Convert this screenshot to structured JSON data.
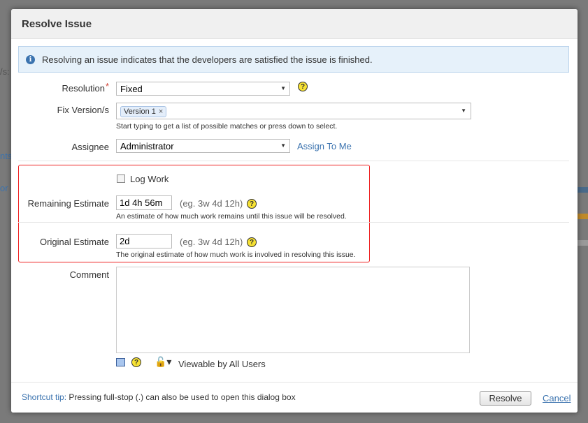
{
  "background": {
    "fragments": [
      "/s:",
      "nts",
      "or"
    ]
  },
  "dialog": {
    "title": "Resolve Issue",
    "info_message": "Resolving an issue indicates that the developers are satisfied the issue is finished.",
    "resolution": {
      "label": "Resolution",
      "required_mark": "*",
      "value": "Fixed"
    },
    "fix_versions": {
      "label": "Fix Version/s",
      "selected": [
        "Version 1"
      ],
      "remove_glyph": "×",
      "description": "Start typing to get a list of possible matches or press down to select."
    },
    "assignee": {
      "label": "Assignee",
      "value": "Administrator",
      "assign_to_me": "Assign To Me"
    },
    "log_work": {
      "label": "Log Work",
      "checked": false
    },
    "remaining_estimate": {
      "label": "Remaining Estimate",
      "value": "1d 4h 56m",
      "hint": "(eg. 3w 4d 12h)",
      "description": "An estimate of how much work remains until this issue will be resolved."
    },
    "original_estimate": {
      "label": "Original Estimate",
      "value": "2d",
      "hint": "(eg. 3w 4d 12h)",
      "description": "The original estimate of how much work is involved in resolving this issue."
    },
    "comment": {
      "label": "Comment",
      "value": "",
      "visibility": "Viewable by All Users"
    },
    "help_glyph": "?",
    "footer": {
      "tip_label": "Shortcut tip:",
      "tip_text": "Pressing full-stop (.) can also be used to open this dialog box",
      "resolve_button": "Resolve",
      "cancel_link": "Cancel"
    }
  },
  "colors": {
    "highlight_box": "#ee2222",
    "link": "#3b73af",
    "info_bg": "#e6f1fa"
  }
}
